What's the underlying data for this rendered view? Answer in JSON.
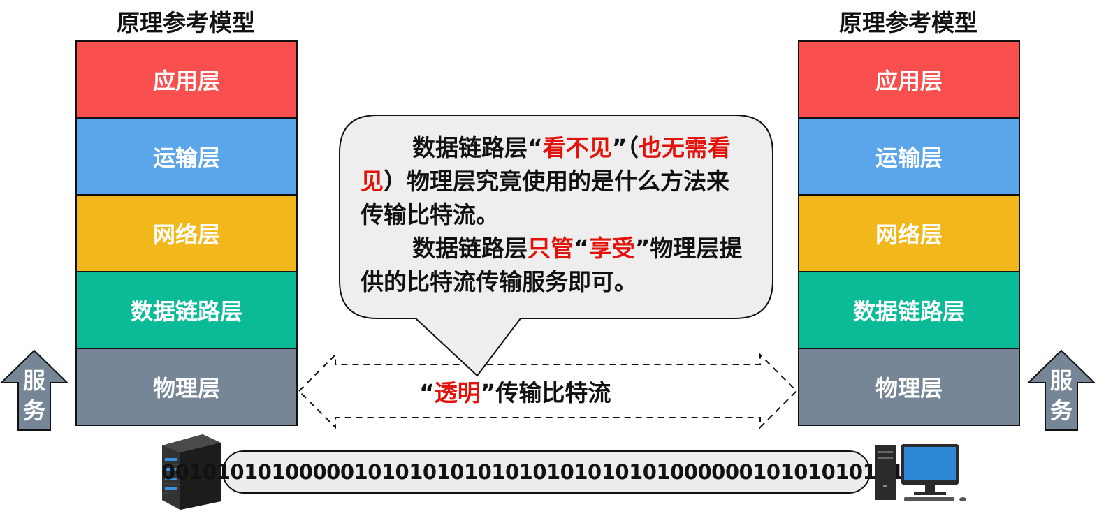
{
  "left_model": {
    "title": "原理参考模型",
    "layers": [
      "应用层",
      "运输层",
      "网络层",
      "数据链路层",
      "物理层"
    ],
    "service_arrow": [
      "服",
      "务"
    ]
  },
  "right_model": {
    "title": "原理参考模型",
    "layers": [
      "应用层",
      "运输层",
      "网络层",
      "数据链路层",
      "物理层"
    ],
    "service_arrow": [
      "服",
      "务"
    ]
  },
  "callout": {
    "p1_part1": "数据链路层“",
    "p1_red1": "看不见",
    "p1_part2": "”（",
    "p1_red2": "也无需看见",
    "p1_part3": "）物理层究竟使用的是什么方法来传输比特流。",
    "p2_part1": "数据链路层",
    "p2_red": "只管",
    "p2_part2": "“",
    "p2_red2": "享受",
    "p2_part3": "”物理层提供的比特流传输服务即可。"
  },
  "transparent_transfer": {
    "open_quote": "“",
    "red": "透明",
    "rest": "”传输比特流"
  },
  "bitstream": "00101010100000101010101010101010101010000001010101010101",
  "colors": {
    "application": "#f94f4f",
    "transport": "#5ba6ea",
    "network": "#f2b81b",
    "data_link": "#0bbb97",
    "physical": "#778697",
    "emphasis": "#e3120b"
  },
  "icons": [
    "server-icon",
    "desktop-computer-icon"
  ]
}
